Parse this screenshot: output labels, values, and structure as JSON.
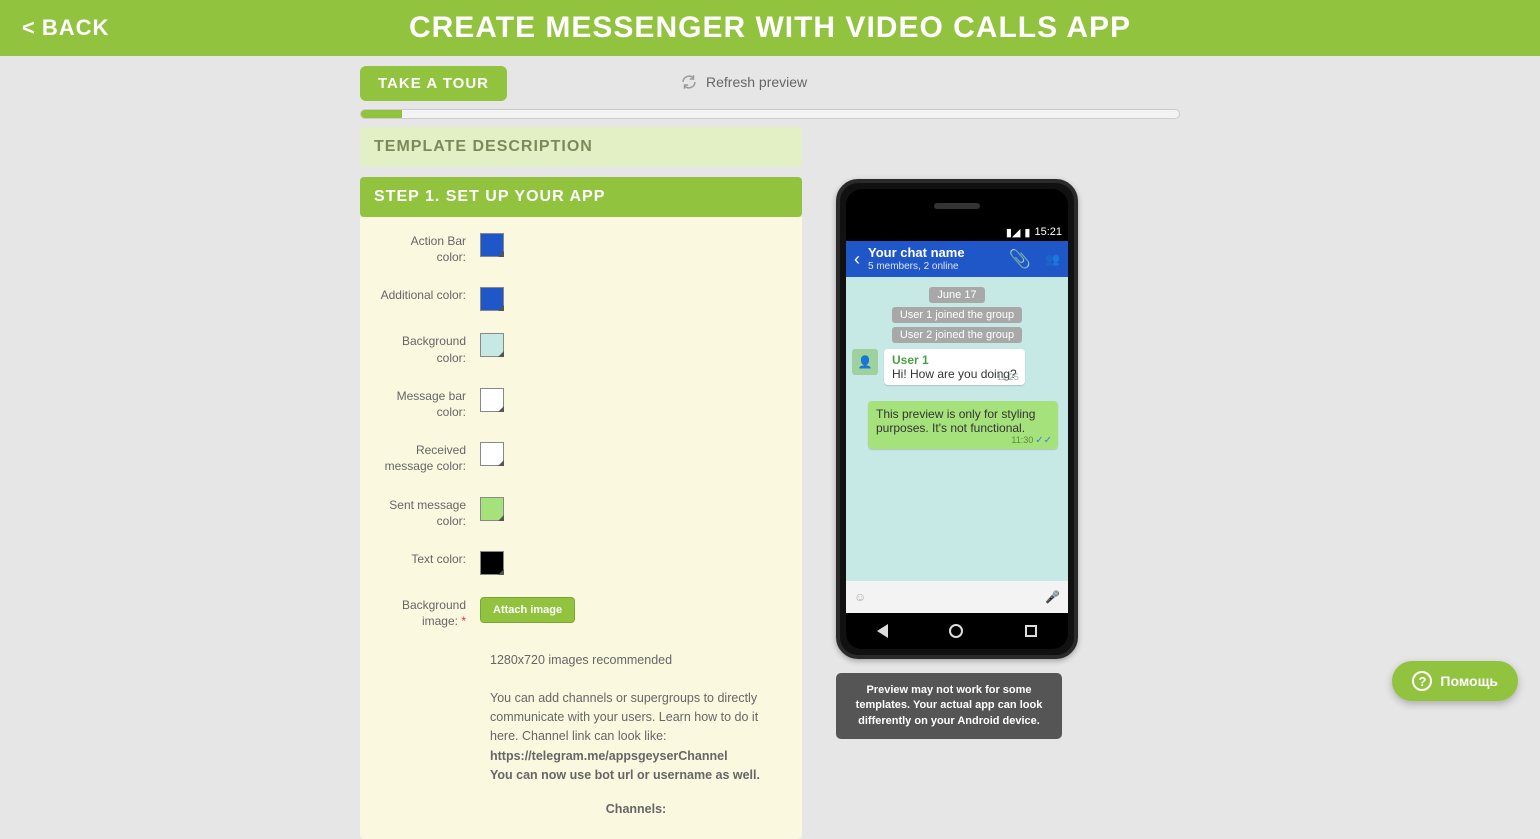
{
  "header": {
    "back": "BACK",
    "title": "CREATE MESSENGER WITH VIDEO CALLS APP"
  },
  "toolbar": {
    "tour": "TAKE A TOUR",
    "refresh": "Refresh preview",
    "progress_pct": 5
  },
  "accordion": {
    "template_desc": "TEMPLATE DESCRIPTION",
    "step1": "STEP 1. SET UP YOUR APP"
  },
  "form": {
    "action_bar": {
      "label": "Action Bar color:",
      "color": "#1f56c8"
    },
    "additional": {
      "label": "Additional color:",
      "color": "#1f56c8"
    },
    "background": {
      "label": "Background color:",
      "color": "#c6e9e6"
    },
    "messagebar": {
      "label": "Message bar color:",
      "color": "#ffffff"
    },
    "received": {
      "label": "Received message color:",
      "color": "#ffffff"
    },
    "sent": {
      "label": "Sent message color:",
      "color": "#a6e27c"
    },
    "text": {
      "label": "Text color:",
      "color": "#000000"
    },
    "bgimage": {
      "label": "Background image:",
      "required": "*",
      "button": "Attach image"
    },
    "hint_reso": "1280x720 images recommended",
    "hint_p1": "You can add channels or supergroups to directly communicate with your users. Learn how to do it here. Channel link can look like:",
    "hint_link": "https://telegram.me/appsgeyserChannel",
    "hint_bot": "You can now use bot url or username as well.",
    "channels_head": "Channels:"
  },
  "preview": {
    "status_time": "15:21",
    "chat_title": "Your chat name",
    "chat_sub": "5 members, 2 online",
    "date_chip": "June 17",
    "join1": "User 1 joined the group",
    "join2": "User 2 joined the group",
    "user1_name": "User 1",
    "user1_msg": "Hi! How are you doing?",
    "user1_time": "11:25",
    "out_msg": "This preview is only for styling purposes. It's not functional.",
    "out_time": "11:30",
    "note": "Preview may not work for some templates. Your actual app can look differently on your Android device."
  },
  "help": {
    "label": "Помощь"
  }
}
